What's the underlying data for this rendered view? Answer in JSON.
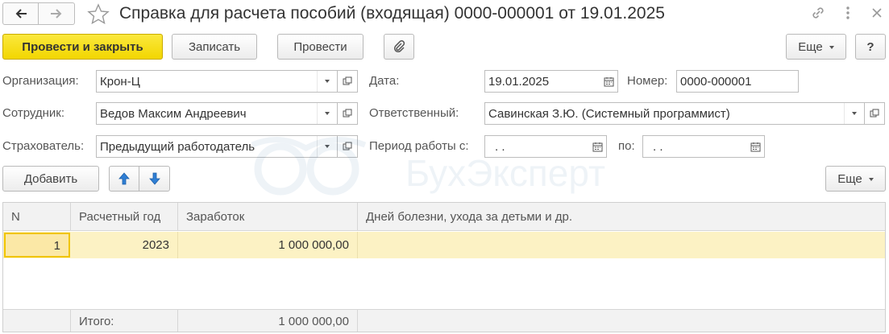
{
  "window": {
    "title": "Справка для расчета пособий (входящая) 0000-000001 от 19.01.2025",
    "icons": [
      "back-arrow-icon",
      "forward-arrow-icon",
      "star-icon",
      "link-icon",
      "more-vertical-icon",
      "close-icon"
    ]
  },
  "toolbar": {
    "post_and_close": "Провести и закрыть",
    "save": "Записать",
    "post": "Провести",
    "attach_icon": "paperclip-icon",
    "more": "Еще",
    "help": "?"
  },
  "form": {
    "organization": {
      "label": "Организация:",
      "value": "Крон-Ц"
    },
    "date": {
      "label": "Дата:",
      "value": "19.01.2025"
    },
    "number": {
      "label": "Номер:",
      "value": "0000-000001"
    },
    "employee": {
      "label": "Сотрудник:",
      "value": "Ведов Максим Андреевич"
    },
    "responsible": {
      "label": "Ответственный:",
      "value": "Савинская З.Ю. (Системный программист)"
    },
    "insurer": {
      "label": "Страхователь:",
      "value": "Предыдущий работодатель"
    },
    "period_from": {
      "label": "Период работы с:",
      "value": " .  ."
    },
    "period_to": {
      "label": "по:",
      "value": " .  ."
    }
  },
  "table_toolbar": {
    "add": "Добавить",
    "more": "Еще",
    "icons": [
      "arrow-up-icon",
      "arrow-down-icon"
    ]
  },
  "table": {
    "columns": [
      "N",
      "Расчетный год",
      "Заработок",
      "Дней болезни, ухода за детьми и др."
    ],
    "rows": [
      {
        "n": "1",
        "year": "2023",
        "earnings": "1 000 000,00",
        "days": ""
      }
    ],
    "footer": {
      "label": "Итого:",
      "earnings": "1 000 000,00"
    }
  },
  "watermark": {
    "text": "БухЭксперт"
  },
  "colors": {
    "primary_button": "#f2d600",
    "selected_row": "#fcf2c4",
    "arrow_blue": "#2f7fd4"
  }
}
